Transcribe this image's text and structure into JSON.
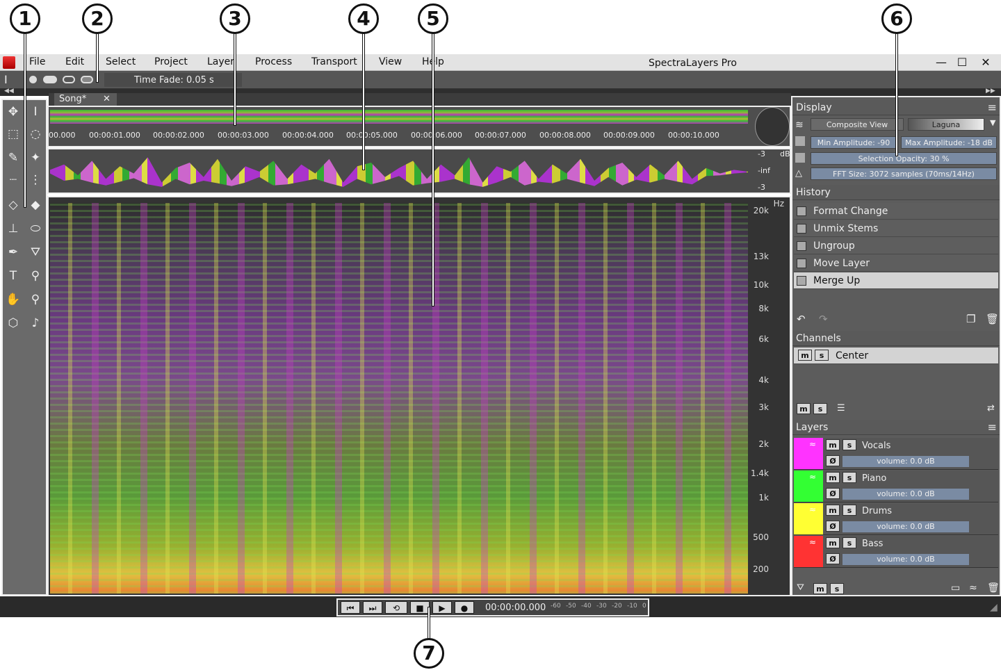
{
  "callouts": [
    "1",
    "2",
    "3",
    "4",
    "5",
    "6",
    "7"
  ],
  "menu": {
    "items": [
      "File",
      "Edit",
      "Select",
      "Project",
      "Layer",
      "Process",
      "Transport",
      "View",
      "Help"
    ],
    "app_title": "SpectraLayers Pro"
  },
  "options": {
    "time_fade": "Time Fade: 0.05 s"
  },
  "tab": {
    "label": "Song*",
    "close": "✕"
  },
  "timeline": {
    "ticks": [
      "00.000",
      "00:00:01.000",
      "00:00:02.000",
      "00:00:03.000",
      "00:00:04.000",
      "00:00:05.000",
      "00:00:06.000",
      "00:00:07.000",
      "00:00:08.000",
      "00:00:09.000",
      "00:00:10.000"
    ]
  },
  "waveform": {
    "db_labels": [
      "-3",
      "-inf",
      "-3"
    ],
    "db_unit": "dB"
  },
  "spectrogram": {
    "freq_labels": [
      "20k",
      "13k",
      "10k",
      "8k",
      "6k",
      "4k",
      "3k",
      "2k",
      "1.4k",
      "1k",
      "500",
      "200"
    ],
    "unit": "Hz"
  },
  "display": {
    "header": "Display",
    "composite_view": "Composite View",
    "palette": "Laguna",
    "min_amp": "Min Amplitude: -90 dB",
    "max_amp": "Max Amplitude: -18 dB",
    "selection_opacity": "Selection Opacity: 30 %",
    "fft_size": "FFT Size: 3072 samples (70ms/14Hz)"
  },
  "history": {
    "header": "History",
    "items": [
      "Format Change",
      "Unmix Stems",
      "Ungroup",
      "Move Layer",
      "Merge Up"
    ]
  },
  "channels": {
    "header": "Channels",
    "items": [
      "Center"
    ],
    "m": "m",
    "s": "s"
  },
  "layers": {
    "header": "Layers",
    "items": [
      {
        "name": "Vocals",
        "color": "#ff33ff",
        "volume": "volume: 0.0 dB"
      },
      {
        "name": "Piano",
        "color": "#33ff33",
        "volume": "volume: 0.0 dB"
      },
      {
        "name": "Drums",
        "color": "#ffff33",
        "volume": "volume: 0.0 dB"
      },
      {
        "name": "Bass",
        "color": "#ff3333",
        "volume": "volume: 0.0 dB"
      }
    ]
  },
  "transport": {
    "time": "00:00:00.000",
    "meter_labels": [
      "-60",
      "-50",
      "-40",
      "-30",
      "-20",
      "-10",
      "0"
    ]
  }
}
